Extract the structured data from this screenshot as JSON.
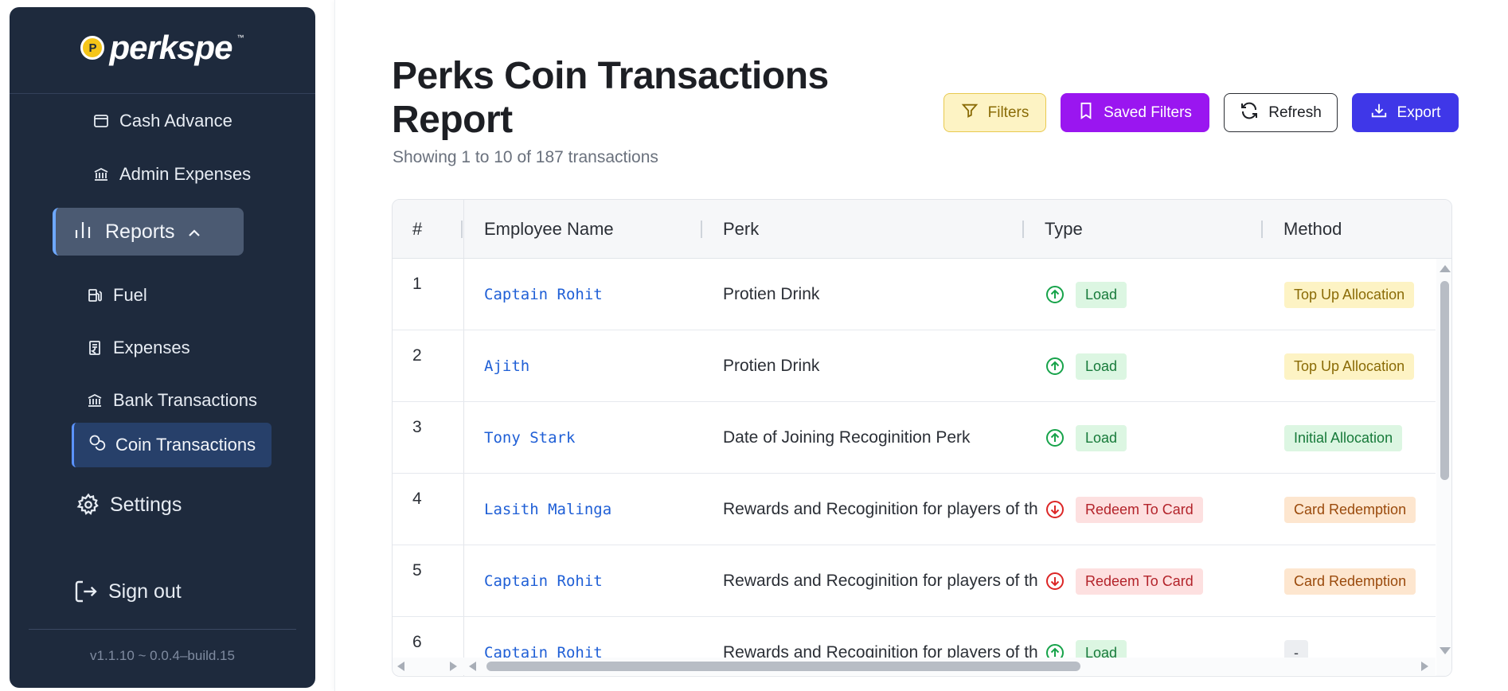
{
  "brand": {
    "name": "perkspe",
    "coin_letter": "P",
    "tm": "™"
  },
  "sidebar": {
    "items": [
      {
        "label": "Cash Advance",
        "icon": "wallet-icon"
      },
      {
        "label": "Admin Expenses",
        "icon": "bank-icon"
      },
      {
        "label": "Reports",
        "icon": "bar-chart-icon"
      },
      {
        "label": "Fuel",
        "icon": "fuel-icon"
      },
      {
        "label": "Expenses",
        "icon": "receipt-icon"
      },
      {
        "label": "Bank Transactions",
        "icon": "bank-icon"
      },
      {
        "label": "Coin Transactions",
        "icon": "coins-icon"
      },
      {
        "label": "Settings",
        "icon": "gear-icon"
      },
      {
        "label": "Sign out",
        "icon": "sign-out-icon"
      }
    ],
    "version": "v1.1.10 ~ 0.0.4–build.15"
  },
  "page": {
    "title": "Perks Coin Transactions Report",
    "subtitle": "Showing 1 to 10 of 187 transactions"
  },
  "toolbar": {
    "filters_label": "Filters",
    "saved_filters_label": "Saved Filters",
    "refresh_label": "Refresh",
    "export_label": "Export"
  },
  "table": {
    "headers": [
      "#",
      "Employee Name",
      "Perk",
      "Type",
      "Method"
    ],
    "rows": [
      {
        "idx": "1",
        "employee": "Captain Rohit",
        "perk": "Protien Drink",
        "type": "Load",
        "method": "Top Up Allocation"
      },
      {
        "idx": "2",
        "employee": "Ajith",
        "perk": "Protien Drink",
        "type": "Load",
        "method": "Top Up Allocation"
      },
      {
        "idx": "3",
        "employee": "Tony Stark",
        "perk": "Date of Joining Recoginition Perk",
        "type": "Load",
        "method": "Initial Allocation"
      },
      {
        "idx": "4",
        "employee": "Lasith Malinga",
        "perk": "Rewards and Recoginition for players of the match",
        "type": "Redeem To Card",
        "method": "Card Redemption"
      },
      {
        "idx": "5",
        "employee": "Captain Rohit",
        "perk": "Rewards and Recoginition for players of the match",
        "type": "Redeem To Card",
        "method": "Card Redemption"
      },
      {
        "idx": "6",
        "employee": "Captain Rohit",
        "perk": "Rewards and Recoginition for players of the match",
        "type": "Load",
        "method": "-"
      }
    ]
  },
  "colors": {
    "sidebar_bg": "#1e2a3d",
    "load_green": "#17a34a",
    "redeem_red": "#dc2626",
    "saved_purple": "#9a16f0",
    "export_indigo": "#3f37e8"
  }
}
